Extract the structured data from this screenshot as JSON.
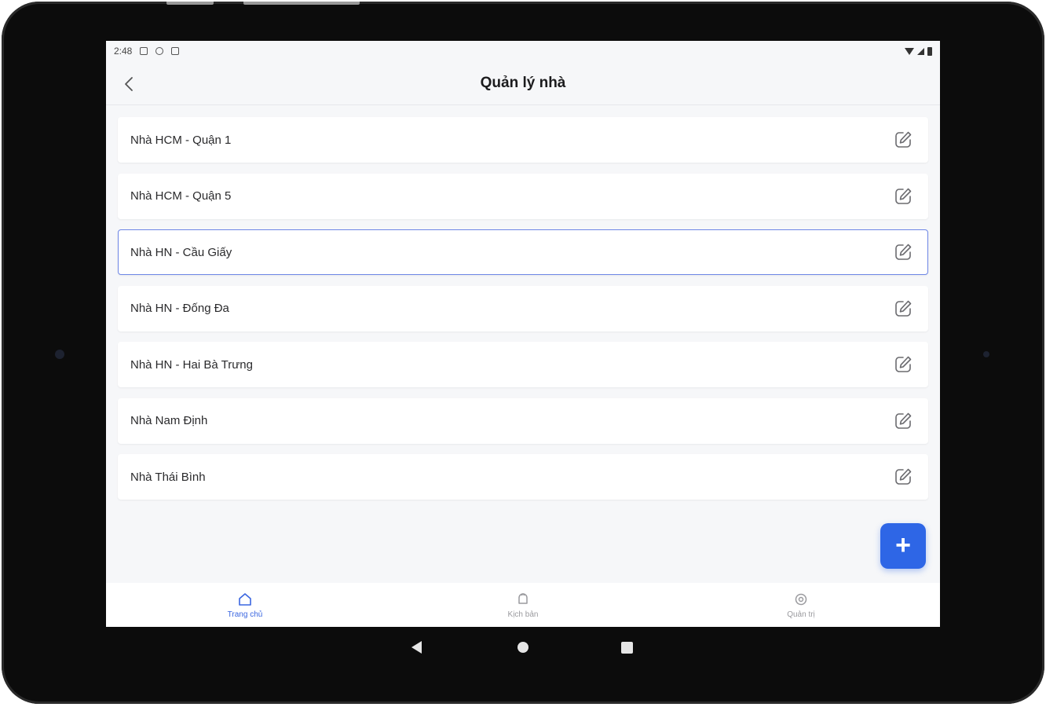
{
  "status_bar": {
    "time": "2:48"
  },
  "header": {
    "title": "Quản lý nhà"
  },
  "houses": [
    {
      "name": "Nhà HCM - Quận 1",
      "selected": false
    },
    {
      "name": "Nhà HCM - Quận 5",
      "selected": false
    },
    {
      "name": "Nhà HN - Cầu Giấy",
      "selected": true
    },
    {
      "name": "Nhà HN - Đống Đa",
      "selected": false
    },
    {
      "name": "Nhà HN - Hai Bà Trưng",
      "selected": false
    },
    {
      "name": "Nhà Nam Định",
      "selected": false
    },
    {
      "name": "Nhà Thái Bình",
      "selected": false
    }
  ],
  "fab": {
    "label": "+",
    "icon": "plus-icon"
  },
  "bottom_nav": {
    "items": [
      {
        "label": "Trang chủ",
        "icon": "home-icon",
        "active": true
      },
      {
        "label": "Kịch bản",
        "icon": "scenario-icon",
        "active": false
      },
      {
        "label": "Quản trị",
        "icon": "settings-icon",
        "active": false
      }
    ]
  },
  "colors": {
    "accent": "#2e66e6",
    "selected_border": "#6d86e6",
    "active_nav": "#3a66e0",
    "background": "#f6f7f9"
  }
}
